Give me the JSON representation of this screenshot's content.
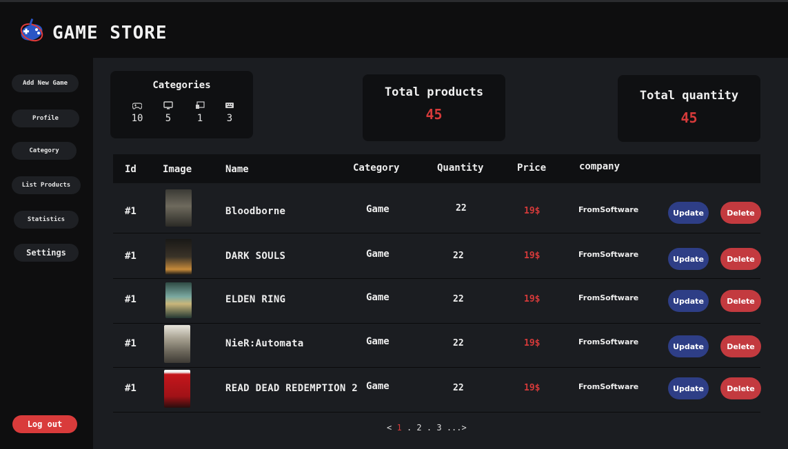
{
  "brand": {
    "name": "GAME STORE",
    "icon": "gamepad-logo-icon"
  },
  "sidebar": {
    "items": [
      {
        "label": "Add New Game"
      },
      {
        "label": "Profile"
      },
      {
        "label": "Category"
      },
      {
        "label": "List Products"
      },
      {
        "label": "Statistics"
      },
      {
        "label": "Settings"
      }
    ],
    "logout": "Log out"
  },
  "cards": {
    "categories": {
      "title": "Categories",
      "items": [
        {
          "icon": "gamepad-icon",
          "value": "10"
        },
        {
          "icon": "monitor-icon",
          "value": "5"
        },
        {
          "icon": "devices-icon",
          "value": "1"
        },
        {
          "icon": "keyboard-icon",
          "value": "3"
        }
      ]
    },
    "total_products": {
      "title": "Total products",
      "value": "45"
    },
    "total_quantity": {
      "title": "Total quantity",
      "value": "45"
    }
  },
  "table": {
    "columns": [
      "Id",
      "Image",
      "Name",
      "Category",
      "Quantity",
      "Price",
      "company"
    ],
    "rows": [
      {
        "id": "#1",
        "name": "Bloodborne",
        "category": "Game",
        "quantity": "22",
        "price": "19$",
        "company": "FromSoftware",
        "cover": "Bloodborne"
      },
      {
        "id": "#1",
        "name": "DARK SOULS",
        "category": "Game",
        "quantity": "22",
        "price": "19$",
        "company": "FromSoftware",
        "cover": "DARK SOULS"
      },
      {
        "id": "#1",
        "name": "ELDEN RING",
        "category": "Game",
        "quantity": "22",
        "price": "19$",
        "company": "FromSoftware",
        "cover": "ELDEN RING"
      },
      {
        "id": "#1",
        "name": "NieR:Automata",
        "category": "Game",
        "quantity": "22",
        "price": "19$",
        "company": "FromSoftware",
        "cover": "NieR:Automata"
      },
      {
        "id": "#1",
        "name": "READ DEAD REDEMPTION 2",
        "category": "Game",
        "quantity": "22",
        "price": "19$",
        "company": "FromSoftware",
        "cover": "RED DEAD REDEMPTION"
      }
    ],
    "update_label": "Update",
    "delete_label": "Delete"
  },
  "pagination": {
    "prev": "<",
    "pages": [
      "1",
      "2",
      "3"
    ],
    "active": "1",
    "sep": ".",
    "more": "...>"
  },
  "colors": {
    "accent": "#d63a3a",
    "update": "#2e3e86",
    "delete": "#c33a3f",
    "background": "#1b1d21",
    "panel": "#0f1012"
  }
}
